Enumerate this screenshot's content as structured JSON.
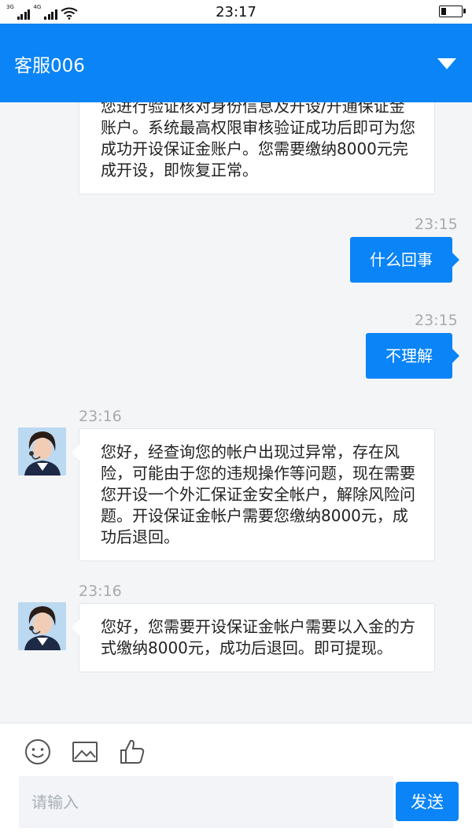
{
  "status_bar": {
    "time": "23:17",
    "network_1": "3G",
    "network_2": "4G",
    "battery_level": 0.25
  },
  "header": {
    "title": "客服006",
    "dropdown_icon": "triangle-down"
  },
  "messages": [
    {
      "sender": "agent",
      "text": "您进行验证核对身份信息及开设/开通保证金账户。系统最高权限审核验证成功后即可为您成功开设保证金账户。您需要缴纳8000元完成开设，即恢复正常。"
    },
    {
      "sender": "user",
      "time": "23:15",
      "text": "什么回事"
    },
    {
      "sender": "user",
      "time": "23:15",
      "text": "不理解"
    },
    {
      "sender": "agent",
      "time": "23:16",
      "text": "您好，经查询您的帐户出现过异常，存在风险，可能由于您的违规操作等问题，现在需要您开设一个外汇保证金安全帐户，解除风险问题。开设保证金帐户需要您缴纳8000元，成功后退回。"
    },
    {
      "sender": "agent",
      "time": "23:16",
      "text": "您好，您需要开设保证金帐户需要以入金的方式缴纳8000元，成功后退回。即可提现。"
    }
  ],
  "composer": {
    "placeholder": "请输入",
    "send_label": "发送",
    "tools": [
      "smiley-icon",
      "image-icon",
      "thumbs-up-icon"
    ]
  },
  "colors": {
    "accent": "#0a84f6",
    "background": "#f4f5f7"
  }
}
